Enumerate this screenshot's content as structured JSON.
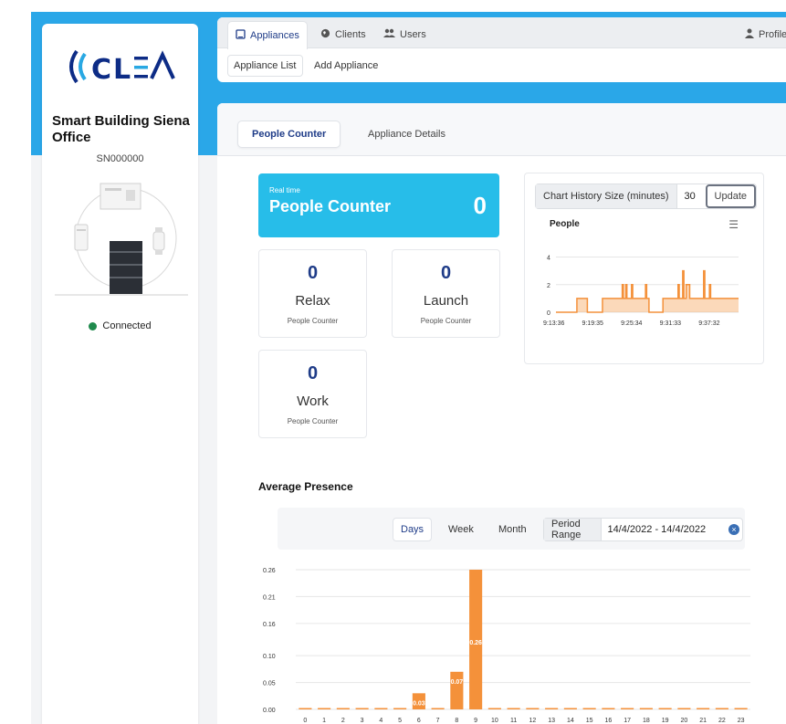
{
  "app": {
    "logo_text": "((CLE/\\"
  },
  "sidebar": {
    "site_title": "Smart Building Siena Office",
    "serial": "SN000000",
    "status": "Connected",
    "status_color": "#1f8a4c"
  },
  "nav": {
    "tabs": [
      {
        "label": "Appliances",
        "icon": "tablet-icon"
      },
      {
        "label": "Clients",
        "icon": "globe-icon"
      },
      {
        "label": "Users",
        "icon": "users-icon"
      }
    ],
    "profile_label": "Profile",
    "subnav": [
      "Appliance List",
      "Add Appliance"
    ]
  },
  "main": {
    "tabs": [
      "People Counter",
      "Appliance Details"
    ]
  },
  "realtime": {
    "small": "Real time",
    "title": "People Counter",
    "value": "0"
  },
  "counters": [
    {
      "value": "0",
      "name": "Relax",
      "sub": "People Counter"
    },
    {
      "value": "0",
      "name": "Launch",
      "sub": "People Counter"
    },
    {
      "value": "0",
      "name": "Work",
      "sub": "People Counter"
    }
  ],
  "history": {
    "label": "Chart History Size (minutes)",
    "value": "30",
    "button": "Update",
    "chart_title": "People"
  },
  "average": {
    "title": "Average Presence",
    "period_buttons": [
      "Days",
      "Week",
      "Month"
    ],
    "range_label": "Period Range",
    "range_value": "14/4/2022 - 14/4/2022"
  },
  "chart_data": [
    {
      "type": "area",
      "title": "People",
      "x_ticks": [
        "9:13:36",
        "9:19:35",
        "9:25:34",
        "9:31:33",
        "9:37:32"
      ],
      "y_ticks": [
        "0",
        "2",
        "4"
      ],
      "ylim": [
        0,
        4.5
      ],
      "color": "#f4913a",
      "values": [
        0,
        0,
        0,
        0,
        0,
        0,
        0,
        0,
        0,
        0,
        0,
        0,
        0,
        0,
        0,
        0,
        0,
        0,
        1,
        1,
        1,
        1,
        1,
        1,
        1,
        1,
        1,
        0,
        0,
        0,
        0,
        0,
        0,
        0,
        0,
        0,
        0,
        0,
        0,
        0,
        1,
        1,
        1,
        1,
        1,
        1,
        1,
        1,
        1,
        1,
        1,
        1,
        1,
        1,
        1,
        1,
        1,
        2,
        1,
        1,
        2,
        1,
        1,
        1,
        1,
        2,
        1,
        1,
        1,
        1,
        1,
        1,
        1,
        1,
        1,
        1,
        1,
        2,
        1,
        1,
        0,
        0,
        0,
        0,
        0,
        0,
        0,
        0,
        0,
        0,
        0,
        0,
        1,
        1,
        1,
        1,
        1,
        1,
        1,
        1,
        1,
        1,
        1,
        1,
        1,
        2,
        1,
        1,
        1,
        3,
        1,
        1,
        2,
        2,
        2,
        1,
        1,
        1,
        1,
        1,
        1,
        1,
        1,
        1,
        1,
        1,
        1,
        3,
        1,
        1,
        1,
        1,
        2,
        1,
        1,
        1,
        1,
        1,
        1,
        1,
        1,
        1,
        1,
        1,
        1,
        1,
        1,
        1,
        1,
        1,
        1,
        1,
        1,
        1,
        1,
        1,
        1,
        1
      ]
    },
    {
      "type": "bar",
      "categories": [
        "0",
        "1",
        "2",
        "3",
        "4",
        "5",
        "6",
        "7",
        "8",
        "9",
        "10",
        "11",
        "12",
        "13",
        "14",
        "15",
        "16",
        "17",
        "18",
        "19",
        "20",
        "21",
        "22",
        "23"
      ],
      "values": [
        0,
        0,
        0,
        0,
        0,
        0,
        0.03,
        0,
        0.07,
        0.26,
        0,
        0,
        0,
        0,
        0,
        0,
        0,
        0,
        0,
        0,
        0,
        0,
        0,
        0
      ],
      "data_labels": {
        "6": "0.03",
        "8": "0.07",
        "9": "0.26"
      },
      "y_ticks": [
        "0.00",
        "0.05",
        "0.10",
        "0.16",
        "0.21",
        "0.26"
      ],
      "ylim": [
        0,
        0.26
      ],
      "color": "#f4913a"
    }
  ]
}
